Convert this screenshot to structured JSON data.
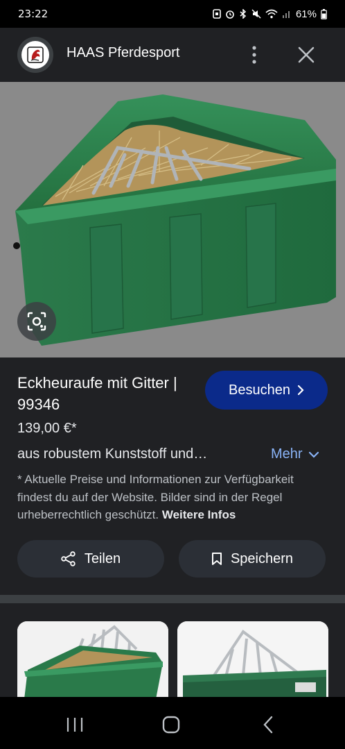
{
  "status_bar": {
    "time": "23:22",
    "battery": "61%",
    "icons": [
      "sim-icon",
      "alarm-icon",
      "bluetooth-icon",
      "mute-icon",
      "wifi-icon",
      "signal-icon",
      "battery-icon"
    ]
  },
  "header": {
    "site_name": "HAAS Pferdesport",
    "more_icon": "more-vert-icon",
    "close_icon": "close-icon"
  },
  "product": {
    "title": "Eckheuraufe mit Gitter | 99346",
    "visit_label": "Besuchen",
    "price": "139,00 €*",
    "description": "aus robustem Kunststoff und…",
    "more_label": "Mehr",
    "disclaimer": "* Aktuelle Preise und Informationen zur Verfügbarkeit findest du auf der Website. Bilder sind in der Regel urheberrechtlich geschützt.",
    "disclaimer_link": "Weitere Infos"
  },
  "actions": {
    "share_label": "Teilen",
    "save_label": "Speichern"
  },
  "colors": {
    "background": "#202124",
    "visit_button": "#0b2a8a",
    "link": "#8ab4f8",
    "feeder_green": "#2e7d4f"
  }
}
